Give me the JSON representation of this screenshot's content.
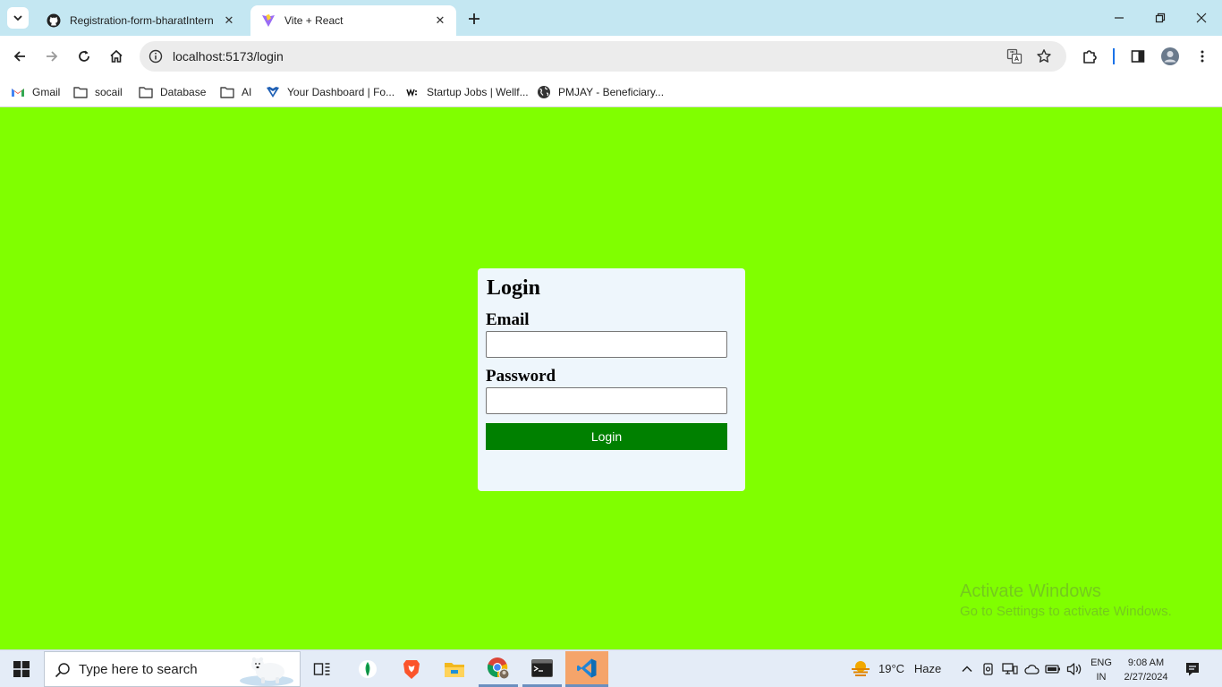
{
  "browser": {
    "tabs": [
      {
        "title": "Registration-form-bharatIntern",
        "favicon": "github-icon",
        "active": false
      },
      {
        "title": "Vite + React",
        "favicon": "vite-icon",
        "active": true
      }
    ],
    "address": {
      "url": "localhost:5173/login"
    },
    "bookmarks": [
      {
        "label": "Gmail",
        "icon": "gmail-icon"
      },
      {
        "label": "socail",
        "icon": "folder-icon"
      },
      {
        "label": "Database",
        "icon": "folder-icon"
      },
      {
        "label": "AI",
        "icon": "folder-icon"
      },
      {
        "label": "Your Dashboard | Fo...",
        "icon": "dashboard-favicon"
      },
      {
        "label": "Startup Jobs | Wellf...",
        "icon": "wellfound-favicon"
      },
      {
        "label": "PMJAY - Beneficiary...",
        "icon": "globe-icon"
      }
    ]
  },
  "login": {
    "title": "Login",
    "email_label": "Email",
    "email_value": "",
    "password_label": "Password",
    "password_value": "",
    "submit_label": "Login"
  },
  "watermark": {
    "title": "Activate Windows",
    "subtitle": "Go to Settings to activate Windows."
  },
  "taskbar": {
    "search_placeholder": "Type here to search",
    "apps": [
      "task-view-icon",
      "mongodb-icon",
      "brave-icon",
      "file-explorer-icon",
      "chrome-icon",
      "terminal-icon",
      "vscode-icon"
    ],
    "weather": {
      "temp": "19°C",
      "condition": "Haze"
    },
    "language": {
      "line1": "ENG",
      "line2": "IN"
    },
    "clock": {
      "time": "9:08 AM",
      "date": "2/27/2024"
    }
  },
  "colors": {
    "page_background": "#80ff00",
    "card_background": "#eef6fc",
    "login_button": "#008000",
    "tabstrip": "#c4e7f2"
  }
}
